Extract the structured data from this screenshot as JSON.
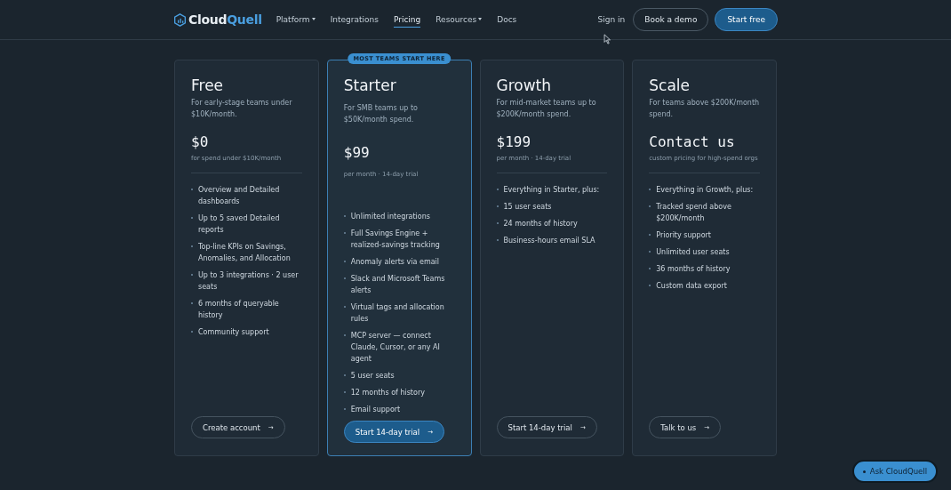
{
  "header": {
    "logo": {
      "first": "Cloud",
      "second": "Quell"
    },
    "nav": [
      {
        "label": "Platform",
        "has_menu": true,
        "selected": false
      },
      {
        "label": "Integrations",
        "has_menu": false,
        "selected": false
      },
      {
        "label": "Pricing",
        "has_menu": false,
        "selected": true
      },
      {
        "label": "Resources",
        "has_menu": true,
        "selected": false
      },
      {
        "label": "Docs",
        "has_menu": false,
        "selected": false
      }
    ],
    "sign_in": "Sign in",
    "demo_button": "Book a demo",
    "start_button": "Start free"
  },
  "plans": [
    {
      "name": "Free",
      "description": "For early-stage teams under $10K/month.",
      "price": "$0",
      "price_note": "for spend under $10K/month",
      "featured": false,
      "features": [
        "Overview and Detailed dashboards",
        "Up to 5 saved Detailed reports",
        "Top-line KPIs on Savings, Anomalies, and Allocation",
        "Up to 3 integrations · 2 user seats",
        "6 months of queryable history",
        "Community support"
      ],
      "cta": "Create account",
      "cta_arrow": "→"
    },
    {
      "name": "Starter",
      "description": "For SMB teams up to $50K/month spend.",
      "price": "$99",
      "price_note": "per month · 14-day trial",
      "featured": true,
      "badge": "MOST TEAMS START HERE",
      "features": [
        "Unlimited integrations",
        "Full Savings Engine + realized-savings tracking",
        "Anomaly alerts via email",
        "Slack and Microsoft Teams alerts",
        "Virtual tags and allocation rules",
        "MCP server — connect Claude, Cursor, or any AI agent",
        "5 user seats",
        "12 months of history",
        "Email support"
      ],
      "cta": "Start 14-day trial",
      "cta_arrow": "→"
    },
    {
      "name": "Growth",
      "description": "For mid-market teams up to $200K/month spend.",
      "price": "$199",
      "price_note": "per month · 14-day trial",
      "featured": false,
      "features": [
        "Everything in Starter, plus:",
        "15 user seats",
        "24 months of history",
        "Business-hours email SLA"
      ],
      "cta": "Start 14-day trial",
      "cta_arrow": "→"
    },
    {
      "name": "Scale",
      "description": "For teams above $200K/month spend.",
      "price": "Contact us",
      "price_note": "custom pricing for high-spend orgs",
      "featured": false,
      "features": [
        "Everything in Growth, plus:",
        "Tracked spend above $200K/month",
        "Priority support",
        "Unlimited user seats",
        "36 months of history",
        "Custom data export"
      ],
      "cta": "Talk to us",
      "cta_arrow": "→"
    }
  ],
  "chat_button": "Ask CloudQuell"
}
